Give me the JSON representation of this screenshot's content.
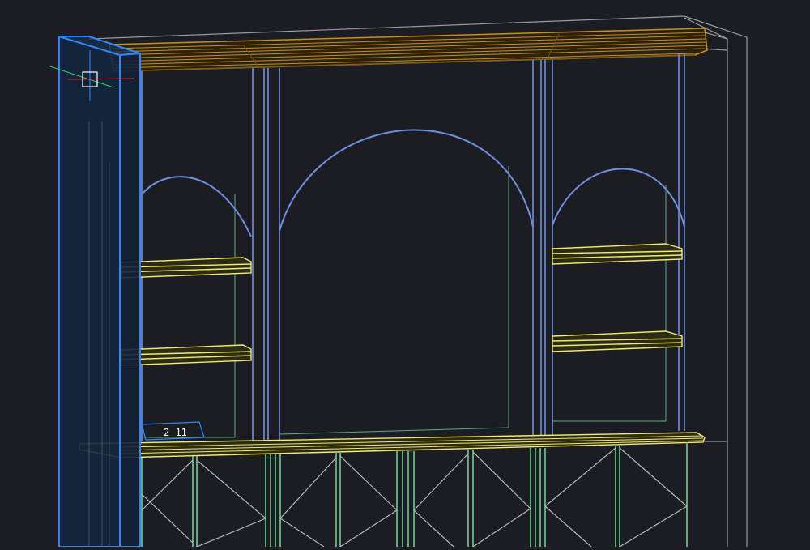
{
  "viewport": {
    "background": "#1b1d22",
    "layers": {
      "crown": "#c8901c",
      "crown_dark": "#7a5510",
      "arches": "#6f8fe0",
      "shelves": "#f2ec6a",
      "lower_cabinet": "#6fcf97",
      "outline": "#9a9a9a",
      "selection": "#2f86ff",
      "selection_fill": "#14263d"
    }
  },
  "dimension_label": {
    "text": "2 11"
  },
  "cursor": {
    "type": "crosshair-pickbox"
  }
}
